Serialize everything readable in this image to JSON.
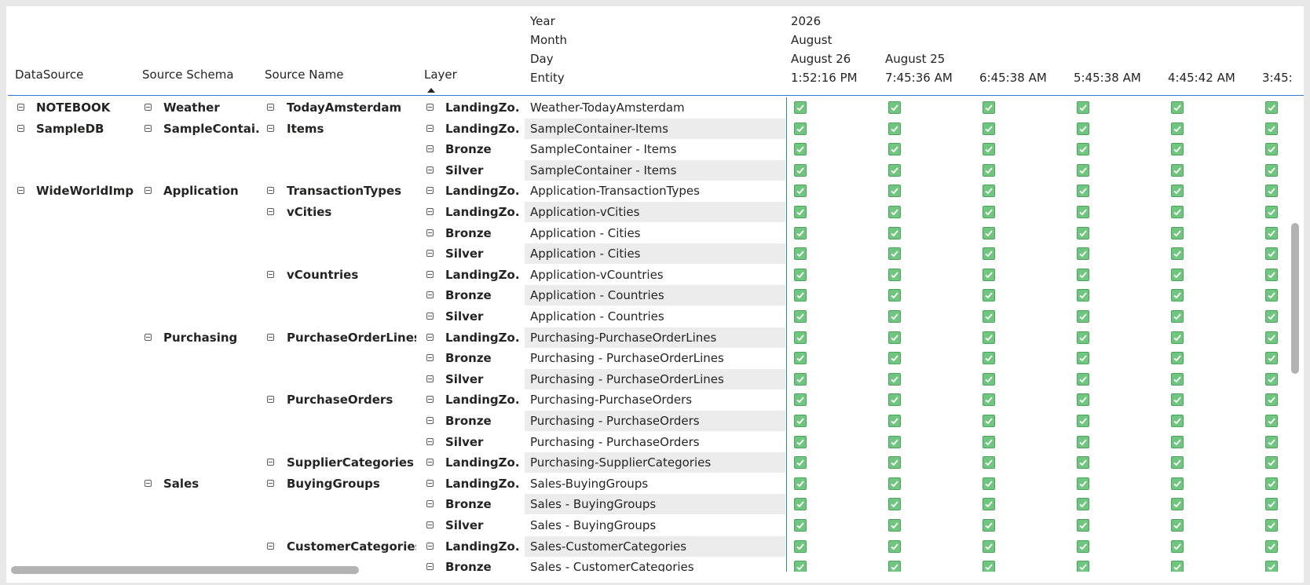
{
  "headers": {
    "datasource": "DataSource",
    "source_schema": "Source Schema",
    "source_name": "Source Name",
    "layer": "Layer",
    "year_label": "Year",
    "month_label": "Month",
    "day_label": "Day",
    "entity_label": "Entity",
    "year_value": "2026",
    "month_value": "August",
    "days": [
      "August 26",
      "August 25"
    ],
    "times": [
      "1:52:16 PM",
      "7:45:36 AM",
      "6:45:38 AM",
      "5:45:38 AM",
      "4:45:42 AM",
      "3:45:"
    ]
  },
  "rows": [
    {
      "ds": "NOTEBOOK",
      "schema": "Weather",
      "name": "TodayAmsterdam",
      "layer": "LandingZo...",
      "entity": "Weather-TodayAmsterdam"
    },
    {
      "ds": "SampleDB",
      "schema": "SampleContai...",
      "name": "Items",
      "layer": "LandingZo...",
      "entity": "SampleContainer-Items"
    },
    {
      "ds": "",
      "schema": "",
      "name": "",
      "layer": "Bronze",
      "entity": "SampleContainer - Items"
    },
    {
      "ds": "",
      "schema": "",
      "name": "",
      "layer": "Silver",
      "entity": "SampleContainer - Items"
    },
    {
      "ds": "WideWorldImp...",
      "schema": "Application",
      "name": "TransactionTypes",
      "layer": "LandingZo...",
      "entity": "Application-TransactionTypes"
    },
    {
      "ds": "",
      "schema": "",
      "name": "vCities",
      "layer": "LandingZo...",
      "entity": "Application-vCities"
    },
    {
      "ds": "",
      "schema": "",
      "name": "",
      "layer": "Bronze",
      "entity": "Application - Cities"
    },
    {
      "ds": "",
      "schema": "",
      "name": "",
      "layer": "Silver",
      "entity": "Application - Cities"
    },
    {
      "ds": "",
      "schema": "",
      "name": "vCountries",
      "layer": "LandingZo...",
      "entity": "Application-vCountries"
    },
    {
      "ds": "",
      "schema": "",
      "name": "",
      "layer": "Bronze",
      "entity": "Application - Countries"
    },
    {
      "ds": "",
      "schema": "",
      "name": "",
      "layer": "Silver",
      "entity": "Application - Countries"
    },
    {
      "ds": "",
      "schema": "Purchasing",
      "name": "PurchaseOrderLines",
      "layer": "LandingZo...",
      "entity": "Purchasing-PurchaseOrderLines"
    },
    {
      "ds": "",
      "schema": "",
      "name": "",
      "layer": "Bronze",
      "entity": "Purchasing - PurchaseOrderLines"
    },
    {
      "ds": "",
      "schema": "",
      "name": "",
      "layer": "Silver",
      "entity": "Purchasing - PurchaseOrderLines"
    },
    {
      "ds": "",
      "schema": "",
      "name": "PurchaseOrders",
      "layer": "LandingZo...",
      "entity": "Purchasing-PurchaseOrders"
    },
    {
      "ds": "",
      "schema": "",
      "name": "",
      "layer": "Bronze",
      "entity": "Purchasing - PurchaseOrders"
    },
    {
      "ds": "",
      "schema": "",
      "name": "",
      "layer": "Silver",
      "entity": "Purchasing - PurchaseOrders"
    },
    {
      "ds": "",
      "schema": "",
      "name": "SupplierCategories",
      "layer": "LandingZo...",
      "entity": "Purchasing-SupplierCategories"
    },
    {
      "ds": "",
      "schema": "Sales",
      "name": "BuyingGroups",
      "layer": "LandingZo...",
      "entity": "Sales-BuyingGroups"
    },
    {
      "ds": "",
      "schema": "",
      "name": "",
      "layer": "Bronze",
      "entity": "Sales - BuyingGroups"
    },
    {
      "ds": "",
      "schema": "",
      "name": "",
      "layer": "Silver",
      "entity": "Sales - BuyingGroups"
    },
    {
      "ds": "",
      "schema": "",
      "name": "CustomerCategories",
      "layer": "LandingZo...",
      "entity": "Sales-CustomerCategories"
    },
    {
      "ds": "",
      "schema": "",
      "name": "",
      "layer": "Bronze",
      "entity": "Sales - CustomerCategories"
    }
  ],
  "check_icon": "checkbox-checked-icon",
  "collapse_icon": "collapse-minus-icon",
  "colors": {
    "check_fill": "#6fc67f",
    "accent_line": "#3a78d6",
    "alt_row": "#ececec"
  }
}
